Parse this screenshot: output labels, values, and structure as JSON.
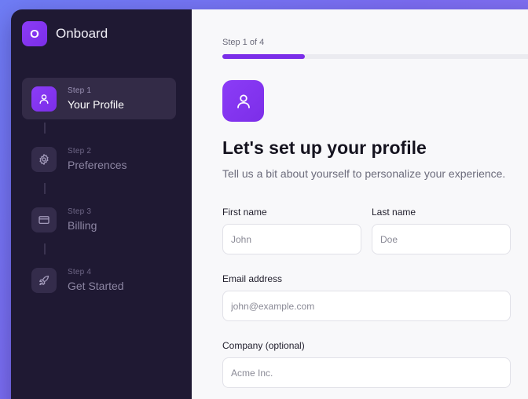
{
  "app": {
    "logo_letter": "O",
    "name": "Onboard"
  },
  "steps": [
    {
      "number_label": "Step 1",
      "title": "Your Profile",
      "icon": "user-icon",
      "active": true
    },
    {
      "number_label": "Step 2",
      "title": "Preferences",
      "icon": "gear-icon",
      "active": false
    },
    {
      "number_label": "Step 3",
      "title": "Billing",
      "icon": "credit-card-icon",
      "active": false
    },
    {
      "number_label": "Step 4",
      "title": "Get Started",
      "icon": "rocket-icon",
      "active": false
    }
  ],
  "progress": {
    "label": "Step 1 of 4",
    "fraction": 0.25
  },
  "hero": {
    "icon": "user-icon"
  },
  "header": {
    "title": "Let's set up your profile",
    "subtitle": "Tell us a bit about yourself to personalize your experience."
  },
  "form": {
    "first_name": {
      "label": "First name",
      "placeholder": "John",
      "value": ""
    },
    "last_name": {
      "label": "Last name",
      "placeholder": "Doe",
      "value": ""
    },
    "email": {
      "label": "Email address",
      "placeholder": "john@example.com",
      "value": ""
    },
    "company": {
      "label": "Company (optional)",
      "placeholder": "Acme Inc.",
      "value": ""
    }
  },
  "colors": {
    "accent": "#7c2ee8",
    "sidebar_bg": "#1f1933",
    "active_step_bg": "#332b47",
    "main_bg": "#f8f8fa"
  }
}
